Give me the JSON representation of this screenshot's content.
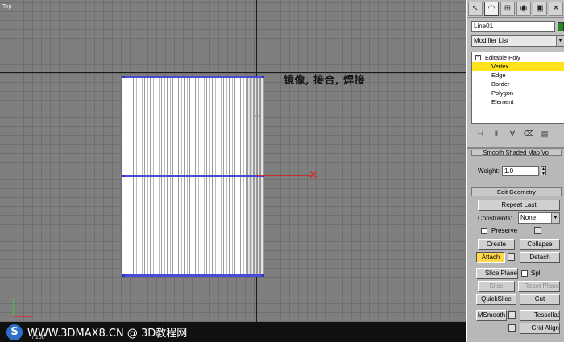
{
  "viewport": {
    "label": "Top",
    "annotation": "镜像, 接合, 焊接"
  },
  "watermark": {
    "logo": "S",
    "text": "WWW.3DMAX8.CN @ 3D教程网",
    "sub": "/ 100"
  },
  "panel": {
    "tabs": [
      "create-tab",
      "modify-tab",
      "hierarchy-tab",
      "motion-tab",
      "display-tab",
      "utilities-tab"
    ],
    "object_name": "Line01",
    "object_color": "#1f8a1f",
    "modifier_list": "Modifier List",
    "stack": {
      "root": "Editable Poly",
      "items": [
        "Vertex",
        "Edge",
        "Border",
        "Polygon",
        "Element"
      ],
      "selected": "Vertex"
    },
    "stack_tools": [
      "pin-stack-icon",
      "show-end-result-icon",
      "make-unique-icon",
      "remove-modifier-icon",
      "configure-sets-icon"
    ],
    "weight": {
      "label": "Weight:",
      "value": "1.0"
    },
    "edit_geometry": {
      "title": "Edit Geometry",
      "toggle": "-",
      "repeat_last": "Repeat Last",
      "constraints_label": "Constraints:",
      "constraints_value": "None",
      "preserve": "Preserve",
      "create": "Create",
      "collapse": "Collapse",
      "attach": "Attach",
      "detach": "Detach",
      "slice_plane": "Slice Plane",
      "split": "Spli",
      "slice": "Slice",
      "reset_plane": "Reset Plane",
      "quickslice": "QuickSlice",
      "cut": "Cut",
      "msmooth": "MSmooth",
      "tessellate": "Tessellat",
      "grid_align": "Grid Align"
    },
    "hidden_rollout_title": "Smooth Shaded Map Vol"
  },
  "colors": {
    "selected_highlight": "#ffe21a",
    "pressed_button": "#ffd94a",
    "gizmo_x": "#c83030",
    "edge_selection": "#4a4ad8"
  }
}
